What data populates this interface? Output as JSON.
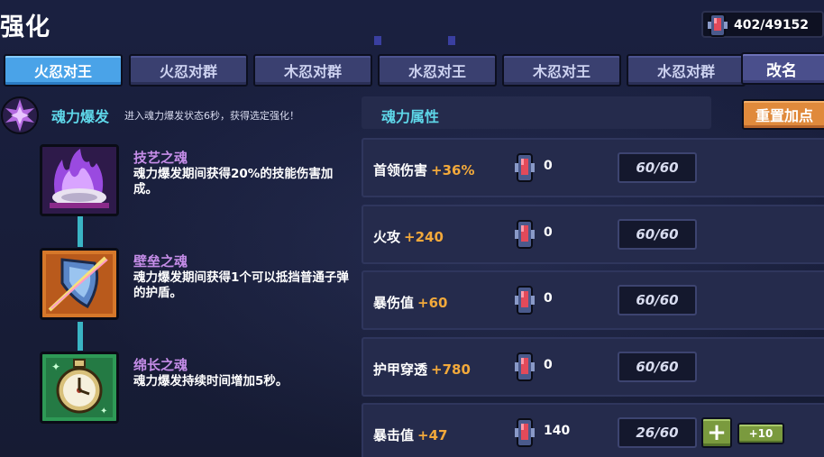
{
  "header": {
    "title": "强化",
    "currency": "402/49152"
  },
  "tabs": [
    {
      "label": "火忍对王",
      "active": true
    },
    {
      "label": "火忍对群",
      "active": false
    },
    {
      "label": "木忍对群",
      "active": false
    },
    {
      "label": "水忍对王",
      "active": false
    },
    {
      "label": "木忍对王",
      "active": false
    },
    {
      "label": "水忍对群",
      "active": false
    }
  ],
  "rename_label": "改名",
  "burst": {
    "title": "魂力爆发",
    "desc": "进入魂力爆发状态6秒，获得选定强化！"
  },
  "souls": [
    {
      "name": "技艺之魂",
      "desc": "魂力爆发期间获得20%的技能伤害加成。",
      "color": "#c58de8",
      "icon": "purple-flame-icon"
    },
    {
      "name": "壁垒之魂",
      "desc": "魂力爆发期间获得1个可以抵挡普通子弹的护盾。",
      "color": "#c58de8",
      "icon": "shield-icon"
    },
    {
      "name": "绵长之魂",
      "desc": "魂力爆发持续时间增加5秒。",
      "color": "#c58de8",
      "icon": "stopwatch-icon"
    }
  ],
  "attributes_title": "魂力属性",
  "reset_label": "重置加点",
  "attributes": [
    {
      "label": "首领伤害",
      "bonus": "+36%",
      "cost": "0",
      "progress": "60/60",
      "can_add": false
    },
    {
      "label": "火攻",
      "bonus": "+240",
      "cost": "0",
      "progress": "60/60",
      "can_add": false
    },
    {
      "label": "暴伤值",
      "bonus": "+60",
      "cost": "0",
      "progress": "60/60",
      "can_add": false
    },
    {
      "label": "护甲穿透",
      "bonus": "+780",
      "cost": "0",
      "progress": "60/60",
      "can_add": false
    },
    {
      "label": "暴击值",
      "bonus": "+47",
      "cost": "140",
      "progress": "26/60",
      "can_add": true
    }
  ],
  "plus_label": "+",
  "plus10_label": "+10",
  "colors": {
    "accent_cyan": "#5ed6e8",
    "bonus_orange": "#f2a93b",
    "active_tab": "#4aa3e8",
    "reset_orange": "#e08a3c",
    "add_green": "#7a9a3e"
  }
}
